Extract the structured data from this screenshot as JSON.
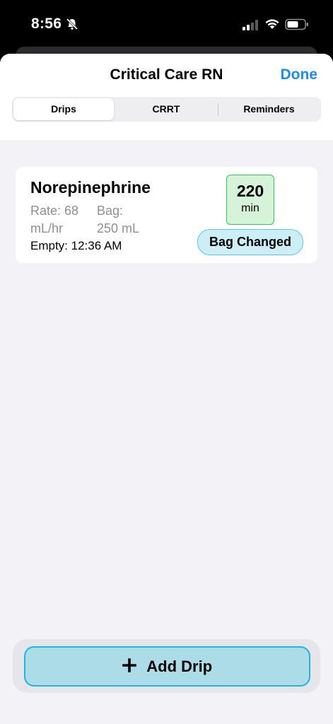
{
  "status_bar": {
    "time": "8:56"
  },
  "nav": {
    "title": "Critical Care RN",
    "done_label": "Done"
  },
  "tabs": [
    {
      "label": "Drips",
      "selected": true
    },
    {
      "label": "CRRT",
      "selected": false
    },
    {
      "label": "Reminders",
      "selected": false
    }
  ],
  "drip": {
    "name": "Norepinephrine",
    "rate_label": "Rate: 68",
    "rate_unit": "mL/hr",
    "bag_label": "Bag:",
    "bag_value": "250 mL",
    "empty_time": "Empty: 12:36 AM",
    "minutes_value": "220",
    "minutes_unit": "min",
    "bag_changed_label": "Bag Changed"
  },
  "add_button": {
    "label": "Add Drip"
  },
  "colors": {
    "accent": "#1a8cf0",
    "timer_bg": "#d6f3d9",
    "timer_border": "#34c759",
    "bag_changed_bg": "#cbeef7",
    "add_button_bg": "#abdce8",
    "add_button_border": "#1fb6e6"
  }
}
